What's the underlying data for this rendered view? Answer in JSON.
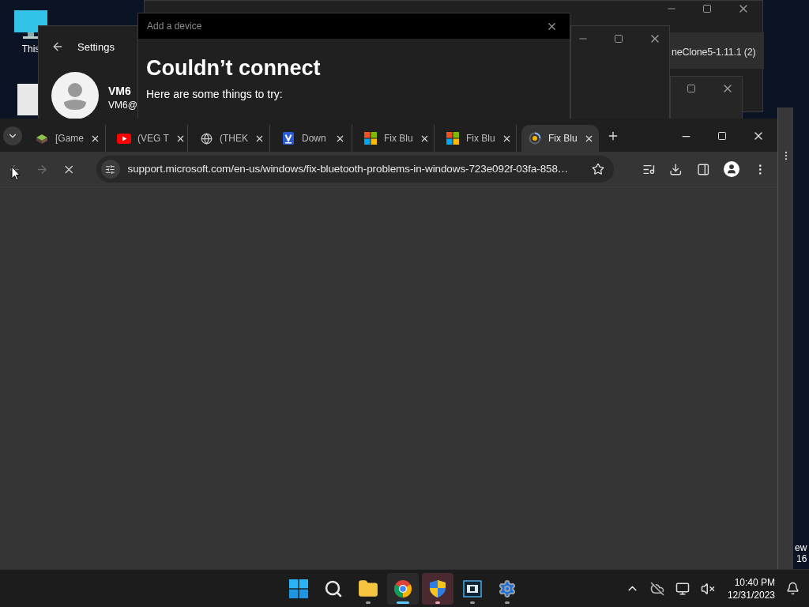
{
  "desktop": {
    "icons": [
      {
        "label": "This"
      }
    ],
    "edge_texts": [
      "ew",
      "16"
    ]
  },
  "background_window": {
    "title": "neClone5-1.11.1 (2)"
  },
  "settings_window": {
    "title": "Settings",
    "user_name": "VM6",
    "user_email": "VM6@"
  },
  "dialog": {
    "title": "Add a device",
    "heading": "Couldn’t connect",
    "text": "Here are some things to try:"
  },
  "browser": {
    "loading": true,
    "url": "support.microsoft.com/en-us/windows/fix-bluetooth-problems-in-windows-723e092f-03fa-858…",
    "tabs": [
      {
        "title": "[Game",
        "kind": "game",
        "selected": false
      },
      {
        "title": "(VEG T",
        "kind": "video",
        "selected": false
      },
      {
        "title": "(THEK",
        "kind": "globe",
        "selected": false
      },
      {
        "title": "Down",
        "kind": "vlogo",
        "selected": false
      },
      {
        "title": "Fix Blu",
        "kind": "windows",
        "selected": false
      },
      {
        "title": "Fix Blu",
        "kind": "windows",
        "selected": false
      },
      {
        "title": "Fix Blu",
        "kind": "spinner",
        "selected": true
      }
    ]
  },
  "taskbar": {
    "apps": [
      {
        "kind": "start",
        "running": false,
        "active": false,
        "attention": false
      },
      {
        "kind": "search",
        "running": false,
        "active": false,
        "attention": false
      },
      {
        "kind": "folder",
        "running": true,
        "active": false,
        "attention": false
      },
      {
        "kind": "chrome",
        "running": true,
        "active": true,
        "attention": false
      },
      {
        "kind": "shield",
        "running": true,
        "active": false,
        "attention": true
      },
      {
        "kind": "film",
        "running": true,
        "active": false,
        "attention": false
      },
      {
        "kind": "settings",
        "running": true,
        "active": false,
        "attention": false
      }
    ],
    "clock": {
      "time": "10:40 PM",
      "date": "12/31/2023"
    }
  }
}
